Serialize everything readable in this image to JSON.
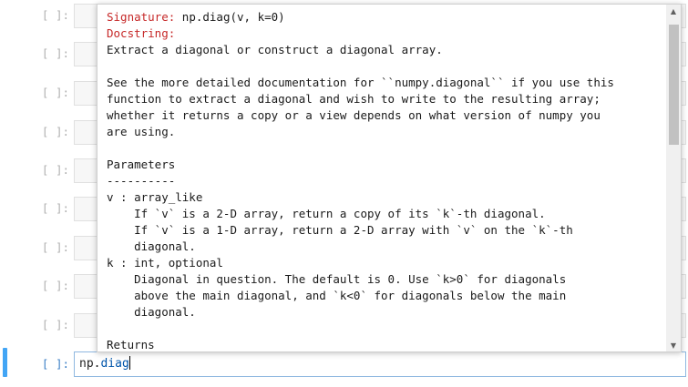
{
  "cells": [
    {
      "prompt": "[ ]:"
    },
    {
      "prompt": "[ ]:"
    },
    {
      "prompt": "[ ]:"
    },
    {
      "prompt": "[ ]:"
    },
    {
      "prompt": "[ ]:"
    },
    {
      "prompt": "[ ]:"
    },
    {
      "prompt": "[ ]:"
    },
    {
      "prompt": "[ ]:"
    },
    {
      "prompt": "[ ]:"
    }
  ],
  "active_cell": {
    "prompt": "[ ]:",
    "code_prefix": "np.",
    "code_name": "diag",
    "accent_color": "#42a5f5"
  },
  "tooltip": {
    "signature_label": "Signature:",
    "signature": " np.diag(v, k=0)",
    "docstring_label": "Docstring:",
    "body": "Extract a diagonal or construct a diagonal array.\n\nSee the more detailed documentation for ``numpy.diagonal`` if you use this\nfunction to extract a diagonal and wish to write to the resulting array;\nwhether it returns a copy or a view depends on what version of numpy you\nare using.\n\nParameters\n----------\nv : array_like\n    If `v` is a 2-D array, return a copy of its `k`-th diagonal.\n    If `v` is a 1-D array, return a 2-D array with `v` on the `k`-th\n    diagonal.\nk : int, optional\n    Diagonal in question. The default is 0. Use `k>0` for diagonals\n    above the main diagonal, and `k<0` for diagonals below the main\n    diagonal.\n\nReturns",
    "header_color": "#c62828"
  },
  "scrollbar": {
    "up_icon": "▲",
    "down_icon": "▼"
  }
}
